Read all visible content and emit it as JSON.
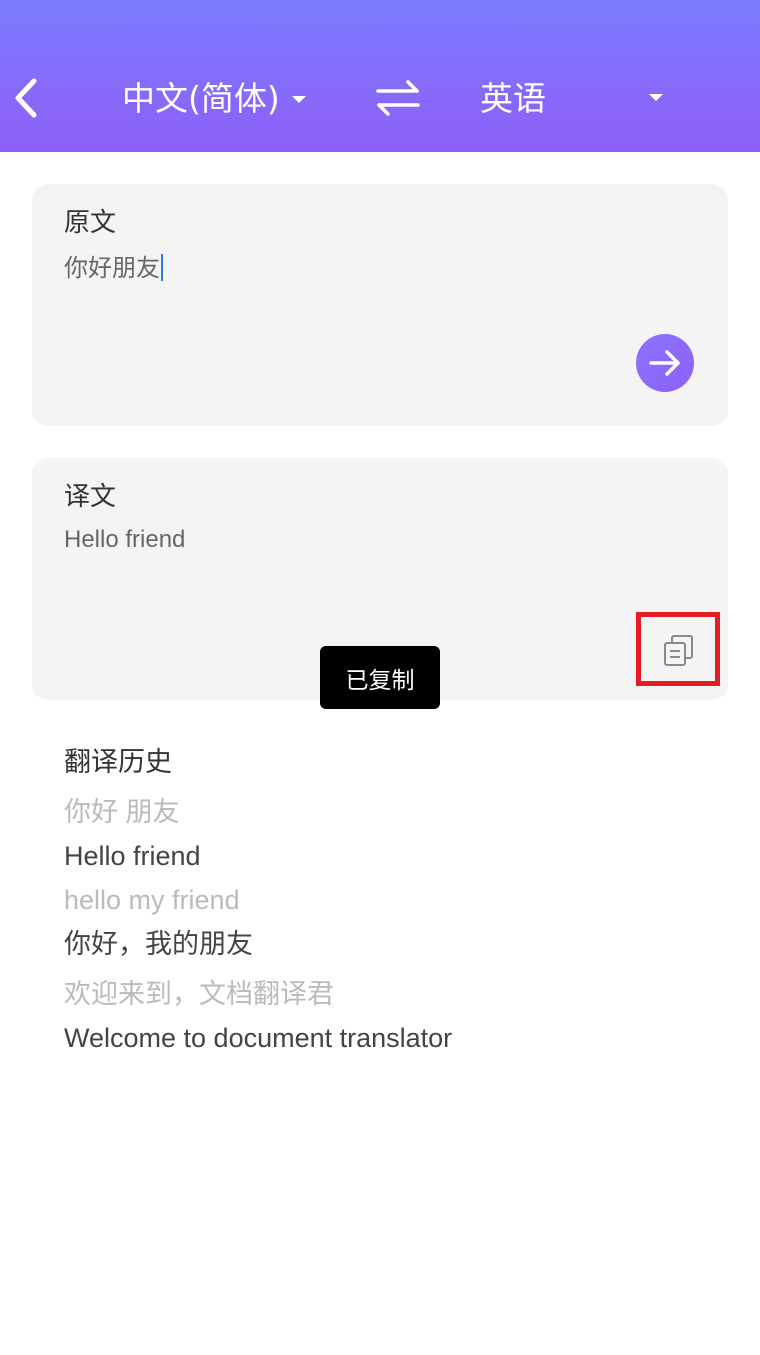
{
  "header": {
    "back_icon": "chevron-left-icon",
    "source_language": "中文(简体)",
    "swap_icon": "swap-arrows-icon",
    "target_language": "英语",
    "colors": {
      "gradient_top": "#7a7cff",
      "gradient_bottom": "#8e5ff7"
    }
  },
  "source_card": {
    "title": "原文",
    "input_value": "你好朋友",
    "translate_icon": "arrow-right-icon"
  },
  "result_card": {
    "title": "译文",
    "result_text": "Hello friend",
    "copy_icon": "copy-icon"
  },
  "toast": {
    "text": "已复制"
  },
  "history": {
    "title": "翻译历史",
    "items": [
      {
        "source": "你好 朋友",
        "translation": "Hello friend"
      },
      {
        "source": "hello my friend",
        "translation": "你好，我的朋友"
      },
      {
        "source": "欢迎来到，文档翻译君",
        "translation": "Welcome to document translator"
      }
    ]
  },
  "highlight_color": "#e51c23"
}
